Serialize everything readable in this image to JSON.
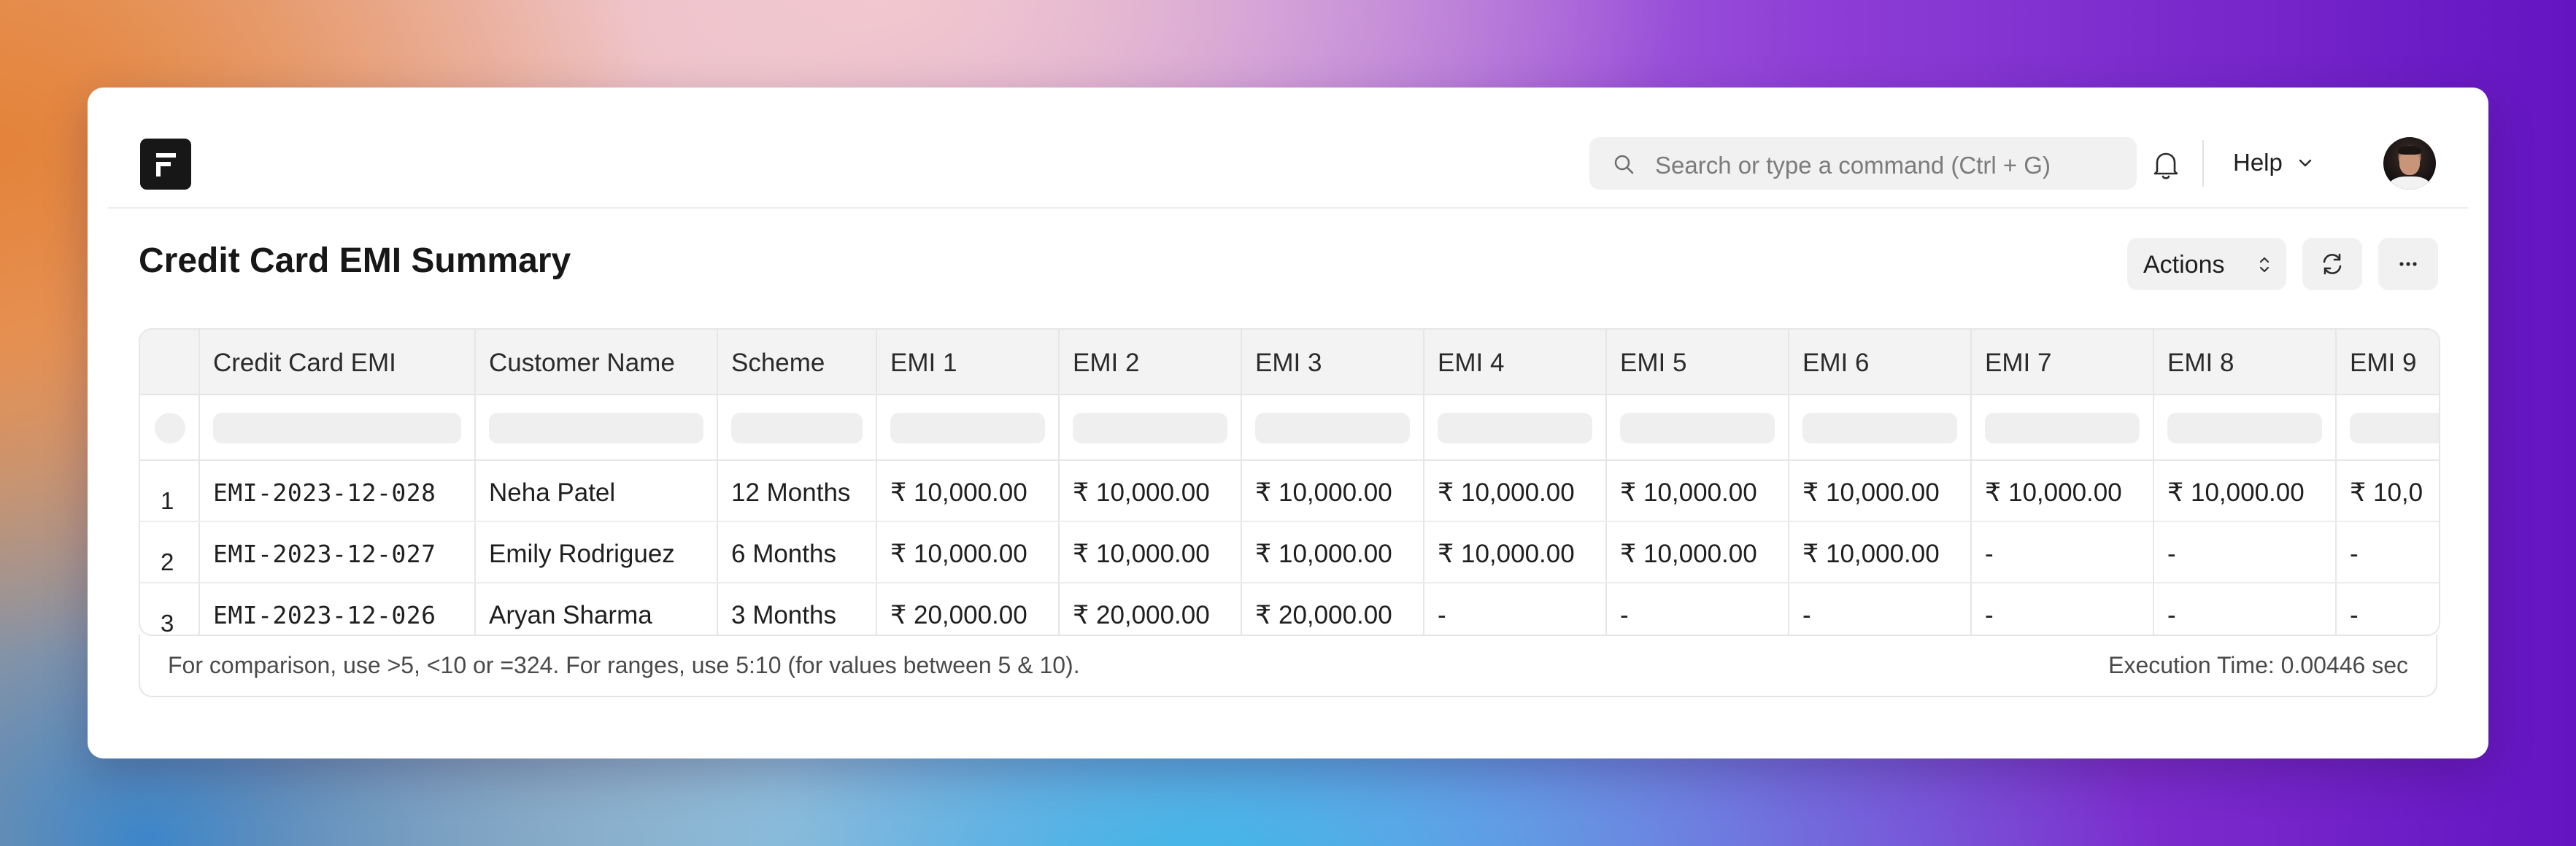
{
  "navbar": {
    "search_placeholder": "Search or type a command (Ctrl + G)",
    "help_label": "Help"
  },
  "page": {
    "title": "Credit Card EMI Summary",
    "actions_label": "Actions"
  },
  "table": {
    "columns": [
      "Credit Card EMI",
      "Customer Name",
      "Scheme",
      "EMI 1",
      "EMI 2",
      "EMI 3",
      "EMI 4",
      "EMI 5",
      "EMI 6",
      "EMI 7",
      "EMI 8",
      "EMI 9"
    ],
    "rows": [
      {
        "num": "1",
        "id": "EMI-2023-12-028",
        "customer": "Neha Patel",
        "scheme": "12 Months",
        "emis": [
          "₹ 10,000.00",
          "₹ 10,000.00",
          "₹ 10,000.00",
          "₹ 10,000.00",
          "₹ 10,000.00",
          "₹ 10,000.00",
          "₹ 10,000.00",
          "₹ 10,000.00",
          "₹ 10,0"
        ]
      },
      {
        "num": "2",
        "id": "EMI-2023-12-027",
        "customer": "Emily Rodriguez",
        "scheme": "6 Months",
        "emis": [
          "₹ 10,000.00",
          "₹ 10,000.00",
          "₹ 10,000.00",
          "₹ 10,000.00",
          "₹ 10,000.00",
          "₹ 10,000.00",
          "-",
          "-",
          "-"
        ]
      },
      {
        "num": "3",
        "id": "EMI-2023-12-026",
        "customer": "Aryan Sharma",
        "scheme": "3 Months",
        "emis": [
          "₹ 20,000.00",
          "₹ 20,000.00",
          "₹ 20,000.00",
          "-",
          "-",
          "-",
          "-",
          "-",
          "-"
        ]
      }
    ]
  },
  "footer": {
    "hint": "For comparison, use >5, <10 or =324. For ranges, use 5:10 (for values between 5 & 10).",
    "execution_time": "Execution Time: 0.00446 sec"
  }
}
